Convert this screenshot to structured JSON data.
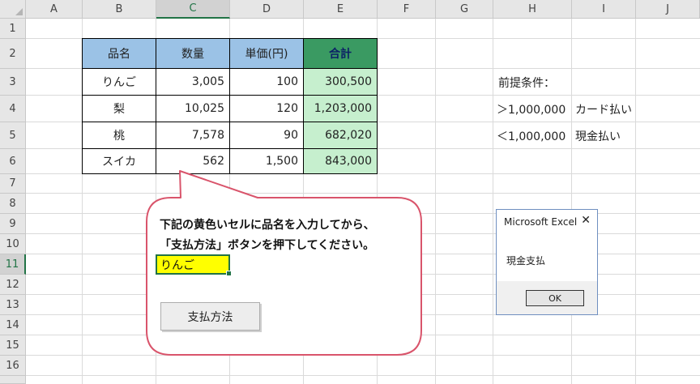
{
  "columns": [
    "A",
    "B",
    "C",
    "D",
    "E",
    "F",
    "G",
    "H",
    "I",
    "J"
  ],
  "rows": [
    "1",
    "2",
    "3",
    "4",
    "5",
    "6",
    "7",
    "8",
    "9",
    "10",
    "11",
    "12",
    "13",
    "14",
    "15",
    "16"
  ],
  "table": {
    "headers": [
      "品名",
      "数量",
      "単価(円)",
      "合計"
    ],
    "rows": [
      [
        "りんご",
        "3,005",
        "100",
        "300,500"
      ],
      [
        "梨",
        "10,025",
        "120",
        "1,203,000"
      ],
      [
        "桃",
        "7,578",
        "90",
        "682,020"
      ],
      [
        "スイカ",
        "562",
        "1,500",
        "843,000"
      ]
    ]
  },
  "conditions": {
    "title": "前提条件：",
    "rule1": {
      "condition": "＞1,000,000",
      "result": "カード払い"
    },
    "rule2": {
      "condition": "＜1,000,000",
      "result": "現金払い"
    }
  },
  "callout": {
    "line1": "下記の黄色いセルに品名を入力してから、",
    "line2": "「支払方法」ボタンを押下してください。",
    "input_value": "りんご",
    "button_label": "支払方法"
  },
  "dialog": {
    "title": "Microsoft Excel",
    "close": "✕",
    "message": "現金支払",
    "ok_label": "OK"
  },
  "colors": {
    "header_blue": "#9bc2e6",
    "header_green": "#3a9a62",
    "value_green": "#c6efce",
    "callout_border": "#d9546b",
    "input_yellow": "#ffff00"
  }
}
